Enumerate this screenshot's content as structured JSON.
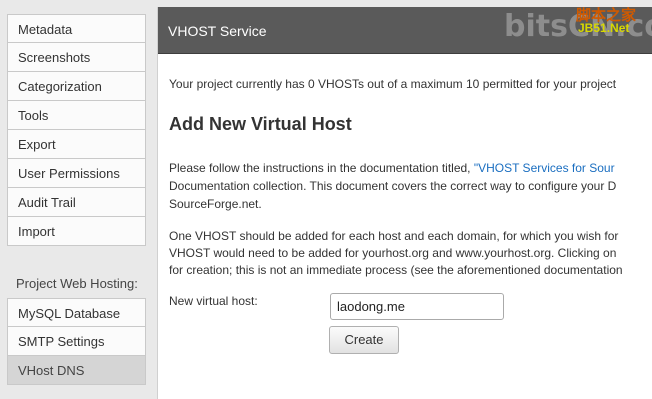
{
  "sidebar": {
    "top_items": [
      {
        "label": "Metadata"
      },
      {
        "label": "Screenshots"
      },
      {
        "label": "Categorization"
      },
      {
        "label": "Tools"
      },
      {
        "label": "Export"
      },
      {
        "label": "User Permissions"
      },
      {
        "label": "Audit Trail"
      },
      {
        "label": "Import"
      }
    ],
    "section_heading": "Project Web Hosting:",
    "bottom_items": [
      {
        "label": "MySQL Database"
      },
      {
        "label": "SMTP Settings"
      },
      {
        "label": "VHost DNS",
        "active": true
      }
    ]
  },
  "panel": {
    "title": "VHOST Service",
    "watermark": {
      "logo": "bitsCN.com",
      "cn_text": "脚本之家",
      "site_text": "JB51.Net"
    }
  },
  "content": {
    "status_text": "Your project currently has 0 VHOSTs out of a maximum 10 permitted for your project",
    "heading": "Add New Virtual Host",
    "para1": {
      "line1_prefix": "Please follow the instructions in the documentation titled, ",
      "line1_link": "\"VHOST Services for Sour",
      "line2": "Documentation collection. This document covers the correct way to configure your D",
      "line3": "SourceForge.net."
    },
    "para2": {
      "line1": "One VHOST should be added for each host and each domain, for which you wish for",
      "line2": "VHOST would need to be added for yourhost.org and www.yourhost.org. Clicking on",
      "line3": "for creation; this is not an immediate process (see the aforementioned documentation"
    },
    "form": {
      "label": "New virtual host:",
      "value": "laodong.me",
      "button": "Create"
    }
  }
}
